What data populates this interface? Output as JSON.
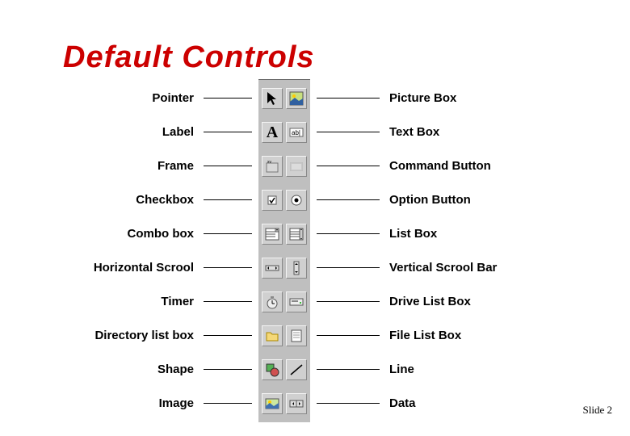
{
  "title": "Default Controls",
  "slide_label": "Slide 2",
  "left_labels": [
    "Pointer",
    "Label",
    "Frame",
    "Checkbox",
    "Combo box",
    "Horizontal Scrool",
    "Timer",
    "Directory list box",
    "Shape",
    "Image"
  ],
  "right_labels": [
    "Picture Box",
    "Text Box",
    "Command Button",
    "Option Button",
    "List Box",
    "Vertical Scrool Bar",
    "Drive List Box",
    "File List Box",
    "Line",
    "Data"
  ],
  "rows": [
    {
      "left_icon": "pointer-icon",
      "right_icon": "picturebox-icon"
    },
    {
      "left_icon": "label-icon",
      "right_icon": "textbox-icon"
    },
    {
      "left_icon": "frame-icon",
      "right_icon": "commandbutton-icon"
    },
    {
      "left_icon": "checkbox-icon",
      "right_icon": "optionbutton-icon"
    },
    {
      "left_icon": "combobox-icon",
      "right_icon": "listbox-icon"
    },
    {
      "left_icon": "hscroll-icon",
      "right_icon": "vscroll-icon"
    },
    {
      "left_icon": "timer-icon",
      "right_icon": "drivelistbox-icon"
    },
    {
      "left_icon": "dirlistbox-icon",
      "right_icon": "filelistbox-icon"
    },
    {
      "left_icon": "shape-icon",
      "right_icon": "line-icon"
    },
    {
      "left_icon": "image-icon",
      "right_icon": "data-icon"
    }
  ]
}
